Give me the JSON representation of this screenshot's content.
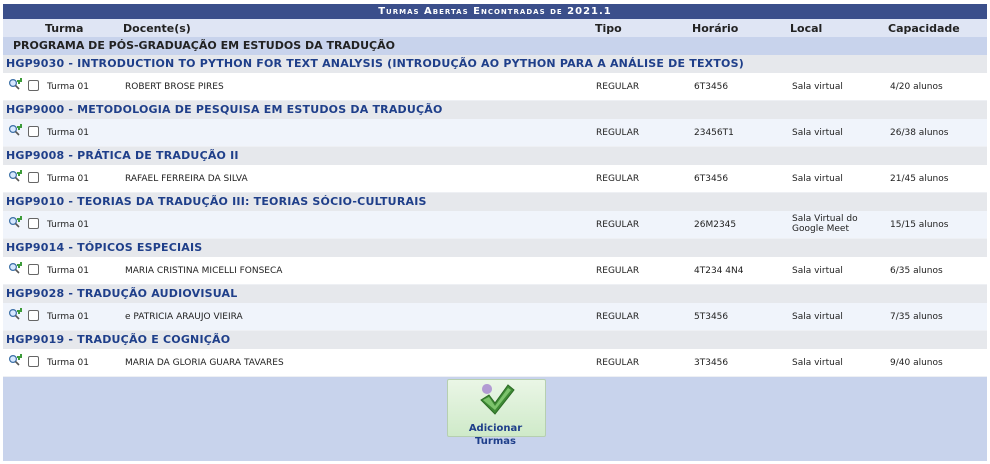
{
  "title": "Turmas Abertas Encontradas de 2021.1",
  "columns": {
    "turma": "Turma",
    "docente": "Docente(s)",
    "tipo": "Tipo",
    "horario": "Horário",
    "local": "Local",
    "capacidade": "Capacidade"
  },
  "program": "PROGRAMA DE PÓS-GRADUAÇÃO EM ESTUDOS DA TRADUÇÃO",
  "courses": [
    {
      "name": "HGP9030 - INTRODUCTION TO PYTHON FOR TEXT ANALYSIS (INTRODUÇÃO AO PYTHON PARA A ANÁLISE DE TEXTOS)",
      "turma": "Turma 01",
      "docente": "ROBERT BROSE PIRES",
      "tipo": "REGULAR",
      "horario": "6T3456",
      "local": "Sala virtual",
      "capacidade": "4/20 alunos"
    },
    {
      "name": "HGP9000 - METODOLOGIA DE PESQUISA EM ESTUDOS DA TRADUÇÃO",
      "turma": "Turma 01",
      "docente": "",
      "tipo": "REGULAR",
      "horario": "23456T1",
      "local": "Sala virtual",
      "capacidade": "26/38 alunos"
    },
    {
      "name": "HGP9008 - PRÁTICA DE TRADUÇÃO II",
      "turma": "Turma 01",
      "docente": "RAFAEL FERREIRA DA SILVA",
      "tipo": "REGULAR",
      "horario": "6T3456",
      "local": "Sala virtual",
      "capacidade": "21/45 alunos"
    },
    {
      "name": "HGP9010 - TEORIAS DA TRADUÇÃO III: TEORIAS SÓCIO-CULTURAIS",
      "turma": "Turma 01",
      "docente": "",
      "tipo": "REGULAR",
      "horario": "26M2345",
      "local": "Sala Virtual do Google Meet",
      "capacidade": "15/15 alunos"
    },
    {
      "name": "HGP9014 - TÓPICOS ESPECIAIS",
      "turma": "Turma 01",
      "docente": "MARIA CRISTINA MICELLI FONSECA",
      "tipo": "REGULAR",
      "horario": "4T234 4N4",
      "local": "Sala virtual",
      "capacidade": "6/35 alunos"
    },
    {
      "name": "HGP9028 - TRADUÇÃO AUDIOVISUAL",
      "turma": "Turma 01",
      "docente": "e PATRICIA ARAUJO VIEIRA",
      "tipo": "REGULAR",
      "horario": "5T3456",
      "local": "Sala virtual",
      "capacidade": "7/35 alunos"
    },
    {
      "name": "HGP9019 - TRADUÇÃO E COGNIÇÃO",
      "turma": "Turma 01",
      "docente": "MARIA DA GLORIA GUARA TAVARES",
      "tipo": "REGULAR",
      "horario": "3T3456",
      "local": "Sala virtual",
      "capacidade": "9/40 alunos"
    }
  ],
  "add_button": {
    "label": "Adicionar Turmas",
    "icon": "checkmark-icon"
  },
  "row_icon": "zoom-details-icon",
  "colors": {
    "title_bg": "#3b4f8b",
    "course_text": "#1f3f8a",
    "program_bg": "#c8d3ec"
  }
}
